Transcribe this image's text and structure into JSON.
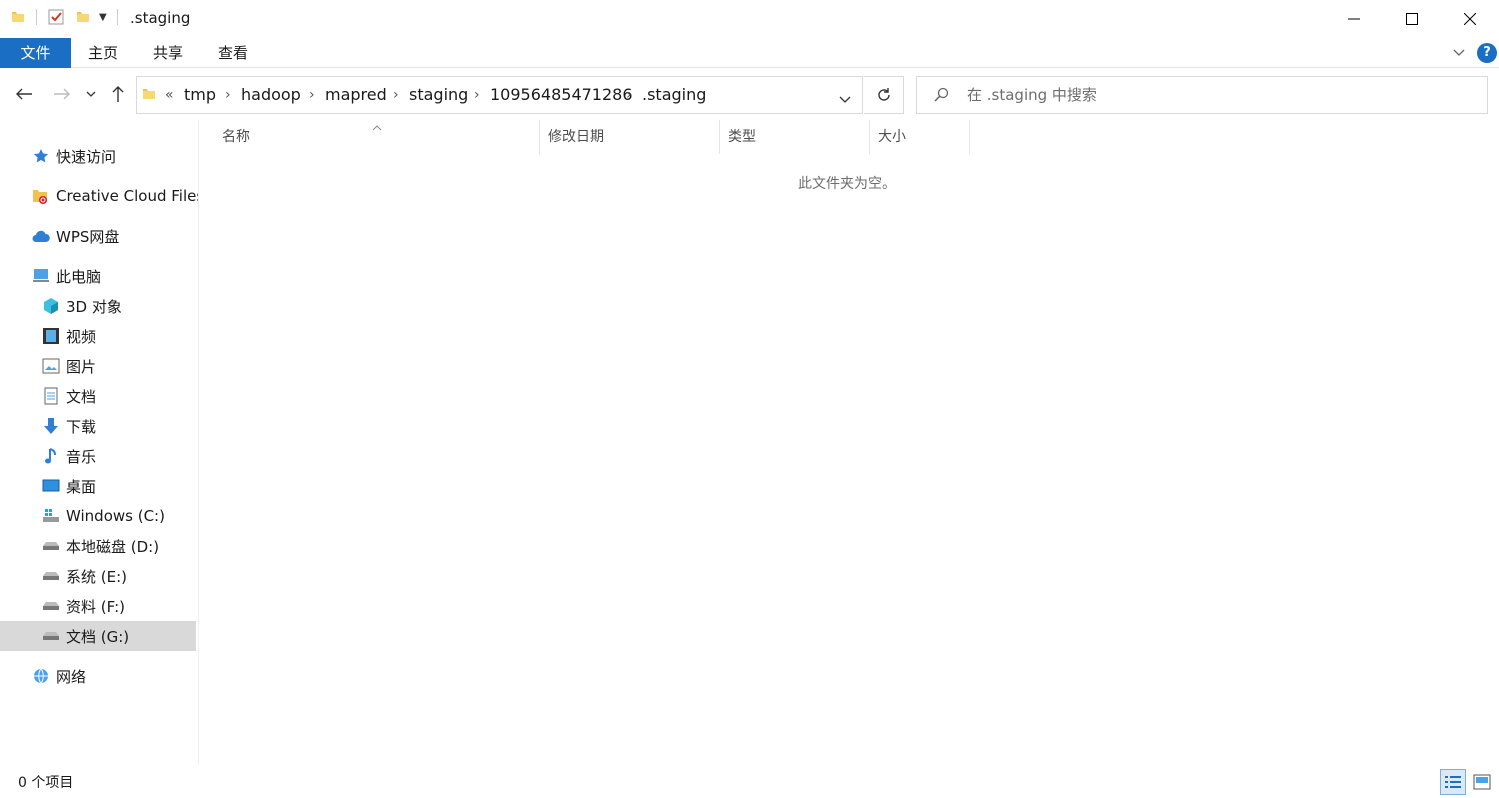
{
  "window": {
    "title": ".staging",
    "controls": [
      "minimize-icon",
      "maximize-icon",
      "close-icon"
    ]
  },
  "ribbon": {
    "tabs": [
      {
        "label": "文件",
        "active": true
      },
      {
        "label": "主页"
      },
      {
        "label": "共享"
      },
      {
        "label": "查看"
      }
    ],
    "accent": "#1a6fc4"
  },
  "address": {
    "overflow": "«",
    "crumbs": [
      "tmp",
      "hadoop",
      "mapred",
      "staging",
      "10956485471286",
      ".staging"
    ],
    "search_placeholder": "在 .staging 中搜索"
  },
  "sidebar": {
    "items": [
      {
        "label": "快速访问",
        "icon": "star-icon"
      },
      {
        "label": "Creative Cloud Files",
        "icon": "creative-cloud-folder-icon"
      },
      {
        "label": "WPS网盘",
        "icon": "cloud-icon"
      },
      {
        "label": "此电脑",
        "icon": "computer-icon"
      },
      {
        "label": "3D 对象",
        "icon": "cube-icon"
      },
      {
        "label": "视频",
        "icon": "film-icon"
      },
      {
        "label": "图片",
        "icon": "picture-icon"
      },
      {
        "label": "文档",
        "icon": "document-icon"
      },
      {
        "label": "下载",
        "icon": "download-arrow-icon"
      },
      {
        "label": "音乐",
        "icon": "music-note-icon"
      },
      {
        "label": "桌面",
        "icon": "desktop-icon"
      },
      {
        "label": "Windows (C:)",
        "icon": "windows-drive-icon"
      },
      {
        "label": "本地磁盘 (D:)",
        "icon": "drive-icon"
      },
      {
        "label": "系统 (E:)",
        "icon": "drive-icon"
      },
      {
        "label": "资料 (F:)",
        "icon": "drive-icon"
      },
      {
        "label": "文档 (G:)",
        "icon": "drive-icon",
        "selected": true
      },
      {
        "label": "网络",
        "icon": "network-icon"
      }
    ]
  },
  "columns": [
    "名称",
    "修改日期",
    "类型",
    "大小"
  ],
  "content": {
    "empty_message": "此文件夹为空。"
  },
  "status": {
    "count": "0 个项目"
  }
}
